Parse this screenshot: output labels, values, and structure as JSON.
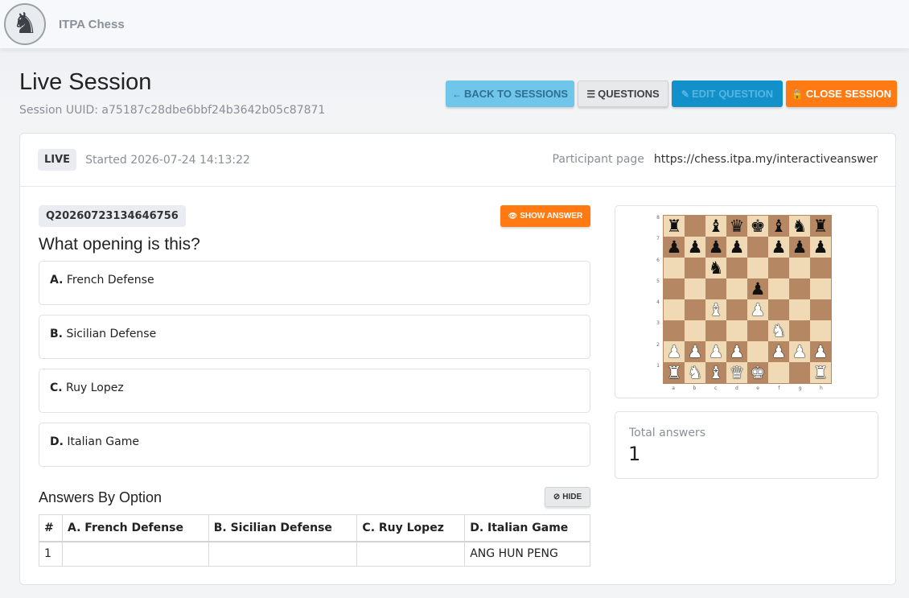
{
  "app": {
    "brand": "ITPA Chess",
    "logo_glyph": "♞"
  },
  "page": {
    "title": "Live Session",
    "session_uuid": "Session UUID: a75187c28dbe6bbf24b3642b05c87871"
  },
  "header_buttons": {
    "back": {
      "icon": "arrow-left-icon",
      "glyph": "←",
      "label": "BACK TO SESSIONS"
    },
    "questions": {
      "icon": "list-icon",
      "glyph": "☰",
      "label": "QUESTIONS"
    },
    "edit": {
      "icon": "edit-icon",
      "glyph": "✎",
      "label": "EDIT QUESTION"
    },
    "close": {
      "icon": "lock-icon",
      "glyph": "🔒",
      "label": "CLOSE SESSION"
    }
  },
  "session": {
    "status_badge": "LIVE",
    "started": "Started 2026-07-24 14:13:22",
    "participant_label": "Participant page",
    "participant_url": "https://chess.itpa.my/interactiveanswer"
  },
  "question": {
    "id": "Q20260723134646756",
    "text": "What opening is this?",
    "show_answer": {
      "icon": "eye-icon",
      "glyph": "👁",
      "label": "SHOW ANSWER"
    },
    "options": [
      {
        "letter": "A.",
        "text": "French Defense"
      },
      {
        "letter": "B.",
        "text": "Sicilian Defense"
      },
      {
        "letter": "C.",
        "text": "Ruy Lopez"
      },
      {
        "letter": "D.",
        "text": "Italian Game"
      }
    ]
  },
  "answers_by_option": {
    "title": "Answers By Option",
    "hide_button": {
      "icon": "eye-slash-icon",
      "glyph": "⊘",
      "label": "HIDE"
    },
    "columns": [
      "#",
      "A. French Defense",
      "B. Sicilian Defense",
      "C. Ruy Lopez",
      "D. Italian Game"
    ],
    "rows": [
      [
        "1",
        "",
        "",
        "",
        "ANG HUN PENG"
      ]
    ]
  },
  "board": {
    "ranks": [
      "8",
      "7",
      "6",
      "5",
      "4",
      "3",
      "2",
      "1"
    ],
    "files": [
      "a",
      "b",
      "c",
      "d",
      "e",
      "f",
      "g",
      "h"
    ],
    "position": [
      [
        "br",
        "",
        "bb",
        "bq",
        "bk",
        "bb",
        "bn",
        "br"
      ],
      [
        "bp",
        "bp",
        "bp",
        "bp",
        "",
        "bp",
        "bp",
        "bp"
      ],
      [
        "",
        "",
        "bn",
        "",
        "",
        "",
        "",
        ""
      ],
      [
        "",
        "",
        "",
        "",
        "bp",
        "",
        "",
        ""
      ],
      [
        "",
        "",
        "wb",
        "",
        "wp",
        "",
        "",
        ""
      ],
      [
        "",
        "",
        "",
        "",
        "",
        "wn",
        "",
        ""
      ],
      [
        "wp",
        "wp",
        "wp",
        "wp",
        "",
        "wp",
        "wp",
        "wp"
      ],
      [
        "wr",
        "wn",
        "wb",
        "wq",
        "wk",
        "",
        "",
        "wr"
      ]
    ]
  },
  "totals": {
    "label": "Total answers",
    "value": "1"
  }
}
